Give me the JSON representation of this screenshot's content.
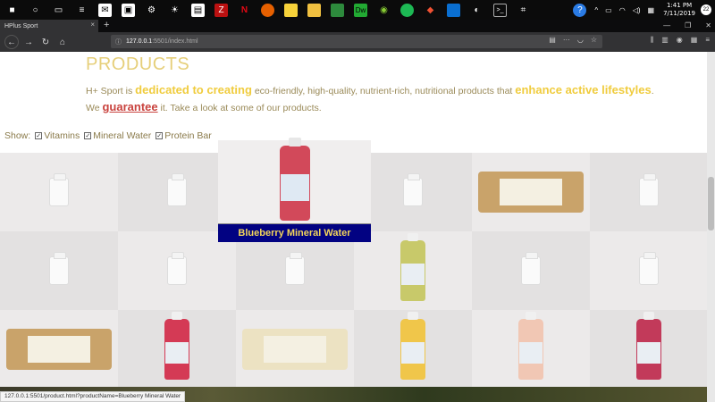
{
  "taskbar": {
    "time": "1:41 PM",
    "date": "7/11/2019",
    "badge": "22"
  },
  "browser": {
    "tab_title": "HPlus Sport",
    "url_host": "127.0.0.1",
    "url_path": ":5501/index.html"
  },
  "page": {
    "heading": "PRODUCTS",
    "intro": {
      "p1": "H+ Sport is ",
      "e1": "dedicated to creating",
      "p2": " eco-friendly, high-quality, nutrient-rich, nutritional products that ",
      "e2": "enhance active lifestyles",
      "p3": ". We ",
      "e3": "guarantee",
      "p4": " it. Take a look at some of our products."
    },
    "filters": {
      "label": "Show:",
      "options": [
        "Vitamins",
        "Mineral Water",
        "Protein Bar"
      ]
    },
    "hover_caption": "Blueberry Mineral Water"
  },
  "status_url": "127.0.0.1:5501/product.html?productName=Blueberry Mineral Water",
  "colors": {
    "heading": "#e6cf7a",
    "emphasis": "#f0cc3e",
    "guarantee": "#c9433e",
    "caption_bg": "#020282",
    "caption_text": "#f4d65a"
  }
}
